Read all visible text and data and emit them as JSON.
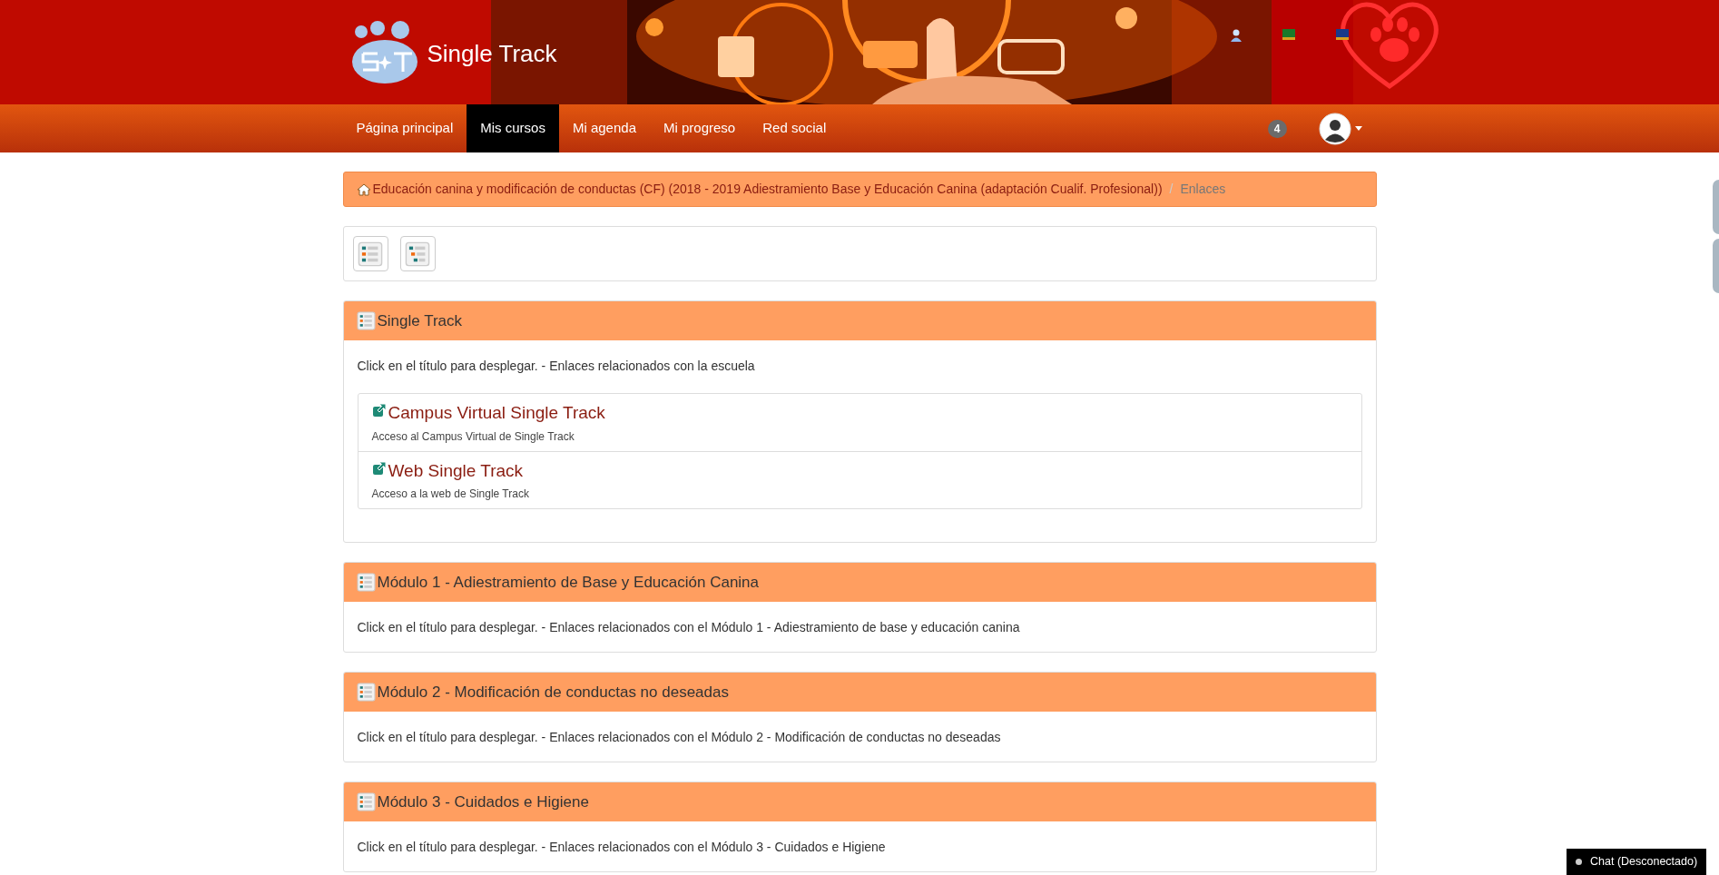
{
  "header": {
    "logo_text": "Single Track"
  },
  "nav": {
    "items": [
      {
        "label": "Página principal",
        "selected": false
      },
      {
        "label": "Mis cursos",
        "selected": true
      },
      {
        "label": "Mi agenda",
        "selected": false
      },
      {
        "label": "Mi progreso",
        "selected": false
      },
      {
        "label": "Red social",
        "selected": false
      }
    ],
    "badge": "4"
  },
  "breadcrumb": [
    {
      "label": "Educación canina y modificación de conductas (CF) (2018 - 2019 Adiestramiento Base y Educación Canina (adaptación Cualif. Profesional))",
      "kind": "link"
    },
    {
      "label": "Enlaces",
      "kind": "current"
    }
  ],
  "breadcrumb_separator": "/",
  "sections": [
    {
      "title": "Single Track",
      "description": "Click en el título para desplegar. - Enlaces relacionados con la escuela",
      "links": [
        {
          "title": "Campus Virtual Single Track",
          "description": "Acceso al Campus Virtual de Single Track"
        },
        {
          "title": "Web Single Track",
          "description": "Acceso a la web de Single Track"
        }
      ]
    },
    {
      "title": "Módulo 1 - Adiestramiento de Base y Educación Canina",
      "description": "Click en el título para desplegar. - Enlaces relacionados con el Módulo 1 - Adiestramiento de base y educación canina"
    },
    {
      "title": "Módulo 2 - Modificación de conductas no deseadas",
      "description": "Click en el título para desplegar. - Enlaces relacionados con el Módulo 2 - Modificación de conductas no deseadas"
    },
    {
      "title": "Módulo 3 - Cuidados e Higiene",
      "description": "Click en el título para desplegar. - Enlaces relacionados con el Módulo 3 - Cuidados e Higiene"
    }
  ],
  "chat": {
    "label": "Chat (Desconectado)"
  }
}
